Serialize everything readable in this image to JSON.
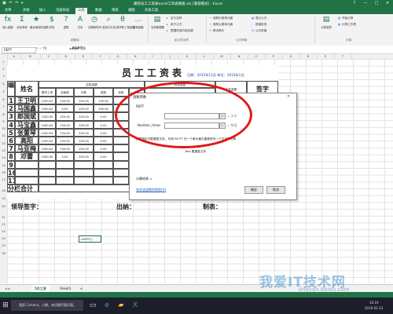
{
  "window": {
    "title": "最新员工工资表excel工资表模板.xls [兼容模式] - Excel",
    "controls": [
      "?",
      "—",
      "□",
      "✕"
    ]
  },
  "menu": {
    "tabs": [
      "文件",
      "开始",
      "插入",
      "页面布局",
      "公式",
      "数据",
      "审阅",
      "视图",
      "开发工具"
    ],
    "active": "公式"
  },
  "ribbon": {
    "buttons": [
      {
        "label": "插入函数",
        "icon": "fx"
      },
      {
        "label": "自动求和",
        "icon": "Σ"
      },
      {
        "label": "最近使用的函数",
        "icon": "★"
      },
      {
        "label": "财务",
        "icon": "$"
      },
      {
        "label": "逻辑",
        "icon": "?"
      },
      {
        "label": "文本",
        "icon": "A"
      },
      {
        "label": "日期和时间",
        "icon": "◷"
      },
      {
        "label": "查找与引用",
        "icon": "⌕"
      },
      {
        "label": "数学和三角函数",
        "icon": "θ"
      },
      {
        "label": "其他函数",
        "icon": "…"
      },
      {
        "label": "名称管理器",
        "icon": "▤"
      }
    ],
    "small": [
      "定义名称",
      "用于公式",
      "根据所选内容创建",
      "追踪引用单元格",
      "追踪从属单元格",
      "移去箭头",
      "显示公式",
      "错误检查",
      "公式求值",
      "计算选项",
      "开始计算",
      "计算工作表"
    ],
    "groups": [
      "函数库",
      "定义的名称",
      "公式审核",
      "计算"
    ]
  },
  "formula_bar": {
    "name_box": "REPT",
    "fx": "fx",
    "content": "=REPT()"
  },
  "columns": [
    "A",
    "B",
    "C",
    "D",
    "E",
    "F",
    "G",
    "H",
    "I",
    "J",
    "K",
    "L",
    "M",
    "N",
    "O",
    "P",
    "Q",
    "R",
    "S",
    "T"
  ],
  "rows": [
    "1",
    "2",
    "3",
    "4",
    "5",
    "6",
    "7",
    "8",
    "9",
    "10",
    "11",
    "12",
    "13",
    "14",
    "15",
    "16",
    "17",
    "18",
    "19",
    "20",
    "21",
    "22",
    "23",
    "24",
    "25",
    "26"
  ],
  "sheet": {
    "title": "员工工资表",
    "date": "日期：2015年12月  单位：2015年1月",
    "headers": {
      "num": "编号",
      "name": "姓名",
      "should_pay": "应发金额",
      "deduct": "应扣金额",
      "actual": "实发金额",
      "sign": "签字",
      "sub": [
        "基本工资",
        "全勤奖",
        "补助",
        "奖励",
        "加班",
        "应发"
      ]
    },
    "employees": [
      {
        "num": "1",
        "name": "王卫明",
        "vals": [
          "1450.00",
          "150.00",
          "200.00",
          "100.00"
        ]
      },
      {
        "num": "2",
        "name": "马国鑫",
        "vals": [
          "1450.00",
          "0.00",
          "200.00",
          "900.00"
        ]
      },
      {
        "num": "3",
        "name": "郎国斌",
        "vals": [
          "1450.00",
          "150.00",
          "200.00",
          "0.00"
        ]
      },
      {
        "num": "4",
        "name": "马宝鑫",
        "vals": [
          "1450.00",
          "150.00",
          "200.00",
          "0.00"
        ]
      },
      {
        "num": "5",
        "name": "张董琴",
        "vals": [
          "1450.00",
          "150.00",
          "200.00",
          "0.00"
        ]
      },
      {
        "num": "6",
        "name": "高阳",
        "vals": [
          "1450.00",
          "150.00",
          "200.00",
          "0.00"
        ]
      },
      {
        "num": "7",
        "name": "马亚梅",
        "vals": [
          "1450.00",
          "150.00",
          "200.00",
          "0.00"
        ]
      },
      {
        "num": "8",
        "name": "邓蕾",
        "vals": [
          "1450.00",
          "0.00",
          "200.00",
          "0.00"
        ]
      },
      {
        "num": "9",
        "name": "",
        "vals": [
          "",
          "",
          "",
          ""
        ]
      },
      {
        "num": "10",
        "name": "",
        "vals": [
          "",
          "",
          "",
          ""
        ]
      },
      {
        "num": "11",
        "name": "",
        "vals": [
          "",
          "",
          "",
          ""
        ]
      }
    ],
    "total": "分栏合计",
    "signature": {
      "leader": "领导签字：",
      "cashier": "出纳：",
      "maker": "制表："
    },
    "active_cell": "=REPT()"
  },
  "dialog": {
    "title": "函数参数",
    "func": "REPT",
    "fields": [
      {
        "label": "Text",
        "value": "",
        "eq": "= 文本"
      },
      {
        "label": "Number_times",
        "value": "",
        "eq": "= 数值"
      }
    ],
    "desc": "根据指定次数重复文本。可用 RE PT 在一个单元格中重复填写一个文本字符串",
    "param_desc": "Text   要重复文本",
    "result": "计算结果 =",
    "help": "有关该函数的帮助(H)",
    "ok": "确定",
    "cancel": "取消"
  },
  "sheets": [
    "5月工资",
    "Sheet3"
  ],
  "taskbar": {
    "search": "我是 Cortana，小娜。有问题尽管问我。",
    "time": "10:19",
    "date": "2016-02-23"
  },
  "watermark": "我爱IT技术网",
  "watermark_url": "jingyan.baidu.com"
}
